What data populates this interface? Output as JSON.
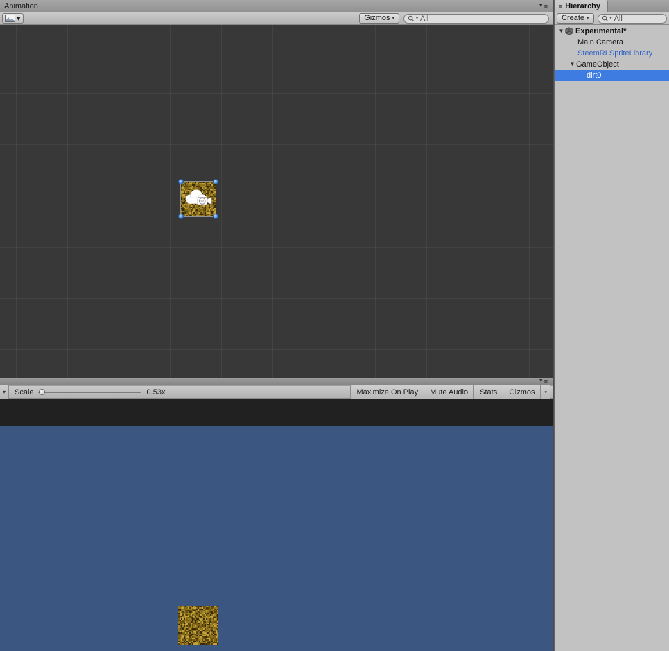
{
  "scene_panel": {
    "tab_label": "Animation",
    "toolbar": {
      "gizmos_label": "Gizmos",
      "search_text": "All"
    }
  },
  "game_panel": {
    "toolbar": {
      "scale_label": "Scale",
      "scale_value": "0.53x",
      "buttons": {
        "maximize": "Maximize On Play",
        "mute": "Mute Audio",
        "stats": "Stats",
        "gizmos": "Gizmos"
      }
    }
  },
  "hierarchy_panel": {
    "tab_label": "Hierarchy",
    "create_label": "Create",
    "search_text": "All",
    "items": [
      {
        "label": "Experimental*"
      },
      {
        "label": "Main Camera"
      },
      {
        "label": "SteemRLSpriteLibrary"
      },
      {
        "label": "GameObject"
      },
      {
        "label": "dirt0"
      }
    ]
  },
  "icons": {
    "foldout_open": "▼",
    "dropdown_arrow": "▾",
    "pane_menu": "≡"
  },
  "colors": {
    "selection_blue": "#3e7ce1",
    "prefab_text_blue": "#2b5fc7",
    "scene_background": "#383838",
    "game_sky_blue": "#3a5681",
    "handle_blue": "#4e90e2"
  }
}
